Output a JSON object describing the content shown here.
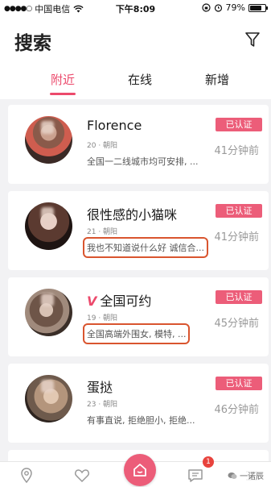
{
  "status_bar": {
    "carrier": "中国电信",
    "time": "下午8:09",
    "battery": "79%",
    "battery_level": 0.79
  },
  "header": {
    "title": "搜索",
    "tabs": [
      {
        "label": "附近",
        "active": true
      },
      {
        "label": "在线",
        "active": false
      },
      {
        "label": "新增",
        "active": false
      }
    ]
  },
  "users": [
    {
      "name": "Florence",
      "meta": "20 · 朝阳",
      "desc": "全国一二线城市均可安排, ...",
      "badge": "已认证",
      "time": "41分钟前",
      "verified_mark": "",
      "highlighted": false
    },
    {
      "name": "很性感的小猫咪",
      "meta": "21 · 朝阳",
      "desc": "我也不知道说什么好 诚信合...",
      "badge": "已认证",
      "time": "41分钟前",
      "verified_mark": "",
      "highlighted": true
    },
    {
      "name": "全国可约",
      "meta": "19 · 朝阳",
      "desc": "全国高端外围女, 模特, ...",
      "badge": "已认证",
      "time": "45分钟前",
      "verified_mark": "V",
      "highlighted": true
    },
    {
      "name": "蛋挞",
      "meta": "23 · 朝阳",
      "desc": "有事直说, 拒绝胆小, 拒绝...",
      "badge": "已认证",
      "time": "46分钟前",
      "verified_mark": "",
      "highlighted": false
    }
  ],
  "bottom_nav": {
    "items": [
      "location-icon",
      "heart-icon",
      "home-icon",
      "message-icon",
      "menu-icon"
    ],
    "message_count": "1"
  },
  "watermark": "一诺辰",
  "colors": {
    "accent": "#ec4a6c",
    "badge": "#ec5d79",
    "highlight_box": "#d9552f"
  }
}
